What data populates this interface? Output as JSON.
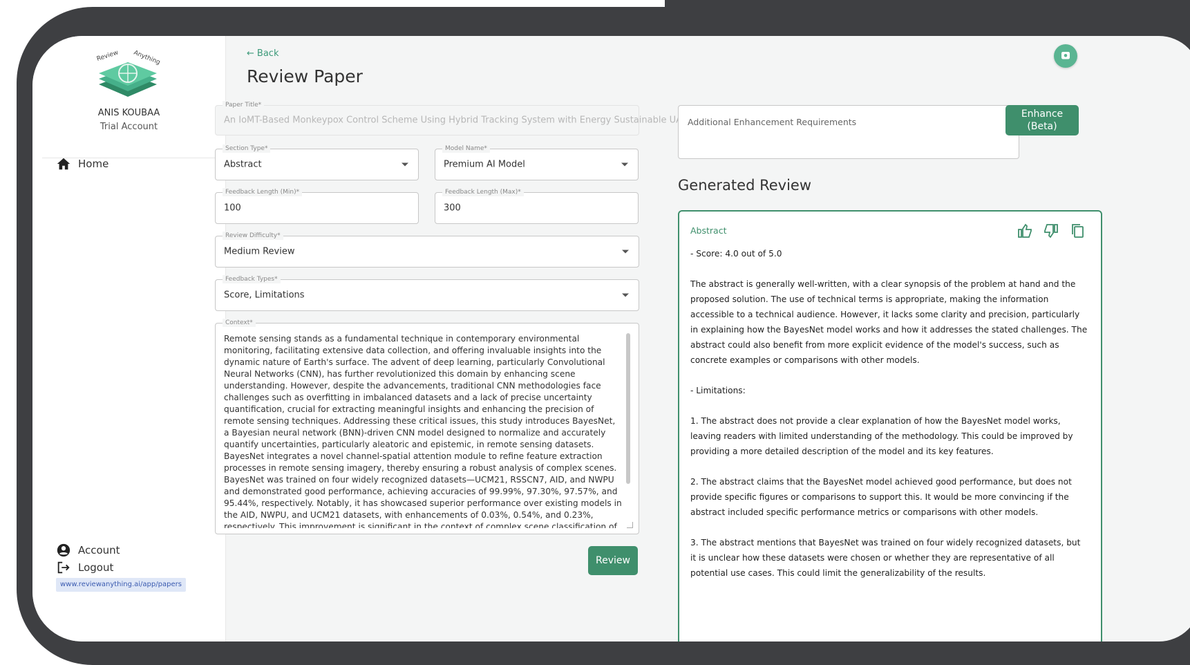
{
  "app": {
    "user_name": "ANIS KOUBAA",
    "account_type": "Trial Account",
    "logo_text_left": "Review",
    "logo_text_right": "Anything"
  },
  "sidebar": {
    "items": [
      {
        "label": "Home",
        "icon": "home-icon"
      },
      {
        "label": "Account",
        "icon": "account-circle-icon"
      },
      {
        "label": "Logout",
        "icon": "logout-icon"
      }
    ],
    "status_url": "www.reviewanything.ai/app/papers"
  },
  "header": {
    "back_label": "Back",
    "title": "Review Paper"
  },
  "form": {
    "paper_title": {
      "label": "Paper Title*",
      "value": "An IoMT-Based Monkeypox Control Scheme Using Hybrid Tracking System with Energy Sustainable UAV"
    },
    "section_type": {
      "label": "Section Type*",
      "value": "Abstract"
    },
    "model_name": {
      "label": "Model Name*",
      "value": "Premium AI Model"
    },
    "feedback_min": {
      "label": "Feedback Length (Min)*",
      "value": "100"
    },
    "feedback_max": {
      "label": "Feedback Length (Max)*",
      "value": "300"
    },
    "review_difficulty": {
      "label": "Review Difficulty*",
      "value": "Medium Review"
    },
    "feedback_types": {
      "label": "Feedback Types*",
      "value": "Score, Limitations"
    },
    "context": {
      "label": "Context*",
      "value": "Remote sensing stands as a fundamental technique in contemporary environmental monitoring, facilitating extensive data collection, and offering invaluable insights into the dynamic nature of Earth's surface. The advent of deep learning, particularly Convolutional Neural Networks (CNN), has further revolutionized this domain by enhancing scene understanding. However, despite the advancements, traditional CNN methodologies face challenges such as overfitting in imbalanced datasets and a lack of precise uncertainty quantification, crucial for extracting meaningful insights and enhancing the precision of remote sensing techniques. Addressing these critical issues, this study introduces BayesNet, a Bayesian neural network (BNN)-driven CNN model designed to normalize and accurately quantify uncertainties, particularly aleatoric and epistemic, in remote sensing datasets. BayesNet integrates a novel channel-spatial attention module to refine feature extraction processes in remote sensing imagery, thereby ensuring a robust analysis of complex scenes. BayesNet was trained on four widely recognized datasets—UCM21, RSSCN7, AID, and NWPU and demonstrated good performance, achieving accuracies of 99.99%, 97.30%, 97.57%, and 95.44%, respectively. Notably, it has showcased superior performance over existing models in the AID, NWPU, and UCM21 datasets, with enhancements of 0.03%, 0.54%, and 0.23%, respectively. This improvement is significant in the context of complex scene classification of remote sensing images, where even slight improvements mark substantial progress against complex and highly optimized benchmarks. Moreover, a self-prepared"
    },
    "review_button": "Review"
  },
  "enhance": {
    "placeholder": "Additional Enhancement Requirements",
    "button_line1": "Enhance",
    "button_line2": "(Beta)"
  },
  "generated": {
    "title": "Generated Review",
    "section": "Abstract",
    "score": "- Score: 4.0 out of 5.0",
    "summary": "The abstract is generally well-written, with a clear synopsis of the problem at hand and the proposed solution. The use of technical terms is appropriate, making the information accessible to a technical audience. However, it lacks some clarity and precision, particularly in explaining how the BayesNet model works and how it addresses the stated challenges. The abstract could also benefit from more explicit evidence of the model's success, such as concrete examples or comparisons with other models.",
    "limitations_heading": "- Limitations:",
    "limitations": [
      "1. The abstract does not provide a clear explanation of how the BayesNet model works, leaving readers with limited understanding of the methodology. This could be improved by providing a more detailed description of the model and its key features.",
      "2. The abstract claims that the BayesNet model achieved good performance, but does not provide specific figures or comparisons to support this. It would be more convincing if the abstract included specific performance metrics or comparisons with other models.",
      "3. The abstract mentions that BayesNet was trained on four widely recognized datasets, but it is unclear how these datasets were chosen or whether they are representative of all potential use cases. This could limit the generalizability of the results."
    ]
  },
  "colors": {
    "accent": "#3f8f6c",
    "frame": "#3e3f42",
    "background": "#f4f5f5"
  }
}
